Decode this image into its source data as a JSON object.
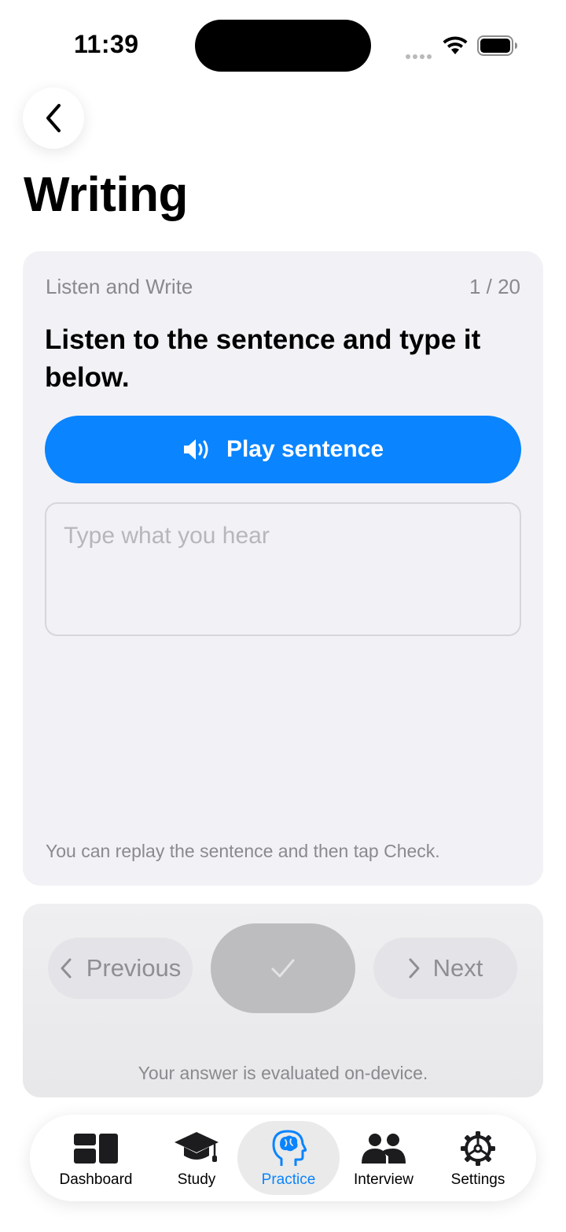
{
  "status_bar": {
    "time": "11:39"
  },
  "header": {
    "title": "Writing"
  },
  "exercise": {
    "label": "Listen and Write",
    "counter": "1 / 20",
    "prompt": "Listen to the sentence and type it below.",
    "play_button_label": "Play sentence",
    "answer_placeholder": "Type what you hear",
    "answer_value": "",
    "hint": "You can replay the sentence and then tap Check."
  },
  "actions": {
    "previous_label": "Previous",
    "next_label": "Next",
    "evaluation_note": "Your answer is evaluated on-device."
  },
  "tab_bar": {
    "items": [
      {
        "label": "Dashboard",
        "icon": "dashboard-icon"
      },
      {
        "label": "Study",
        "icon": "graduation-cap-icon"
      },
      {
        "label": "Practice",
        "icon": "brain-head-icon",
        "active": true
      },
      {
        "label": "Interview",
        "icon": "people-icon"
      },
      {
        "label": "Settings",
        "icon": "gear-icon"
      }
    ]
  },
  "colors": {
    "accent": "#0a84ff",
    "card_background": "#f2f2f6",
    "disabled": "#bdbdc0"
  }
}
